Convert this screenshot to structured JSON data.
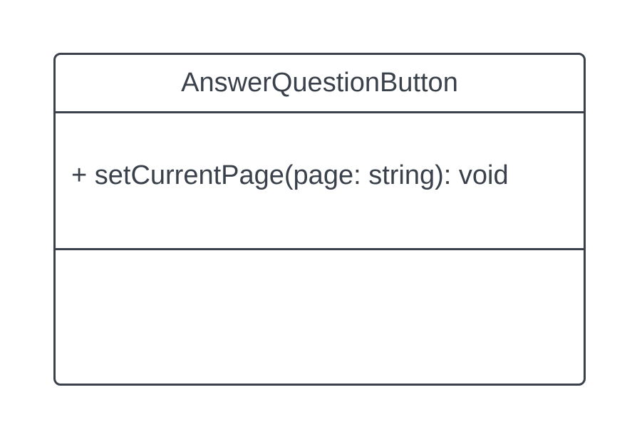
{
  "diagram": {
    "class": {
      "name": "AnswerQuestionButton",
      "top_section_members": [
        "+ setCurrentPage(page: string): void"
      ],
      "bottom_section_members": []
    }
  },
  "colors": {
    "stroke": "#3a414a",
    "text": "#3a414a",
    "background": "#ffffff"
  }
}
